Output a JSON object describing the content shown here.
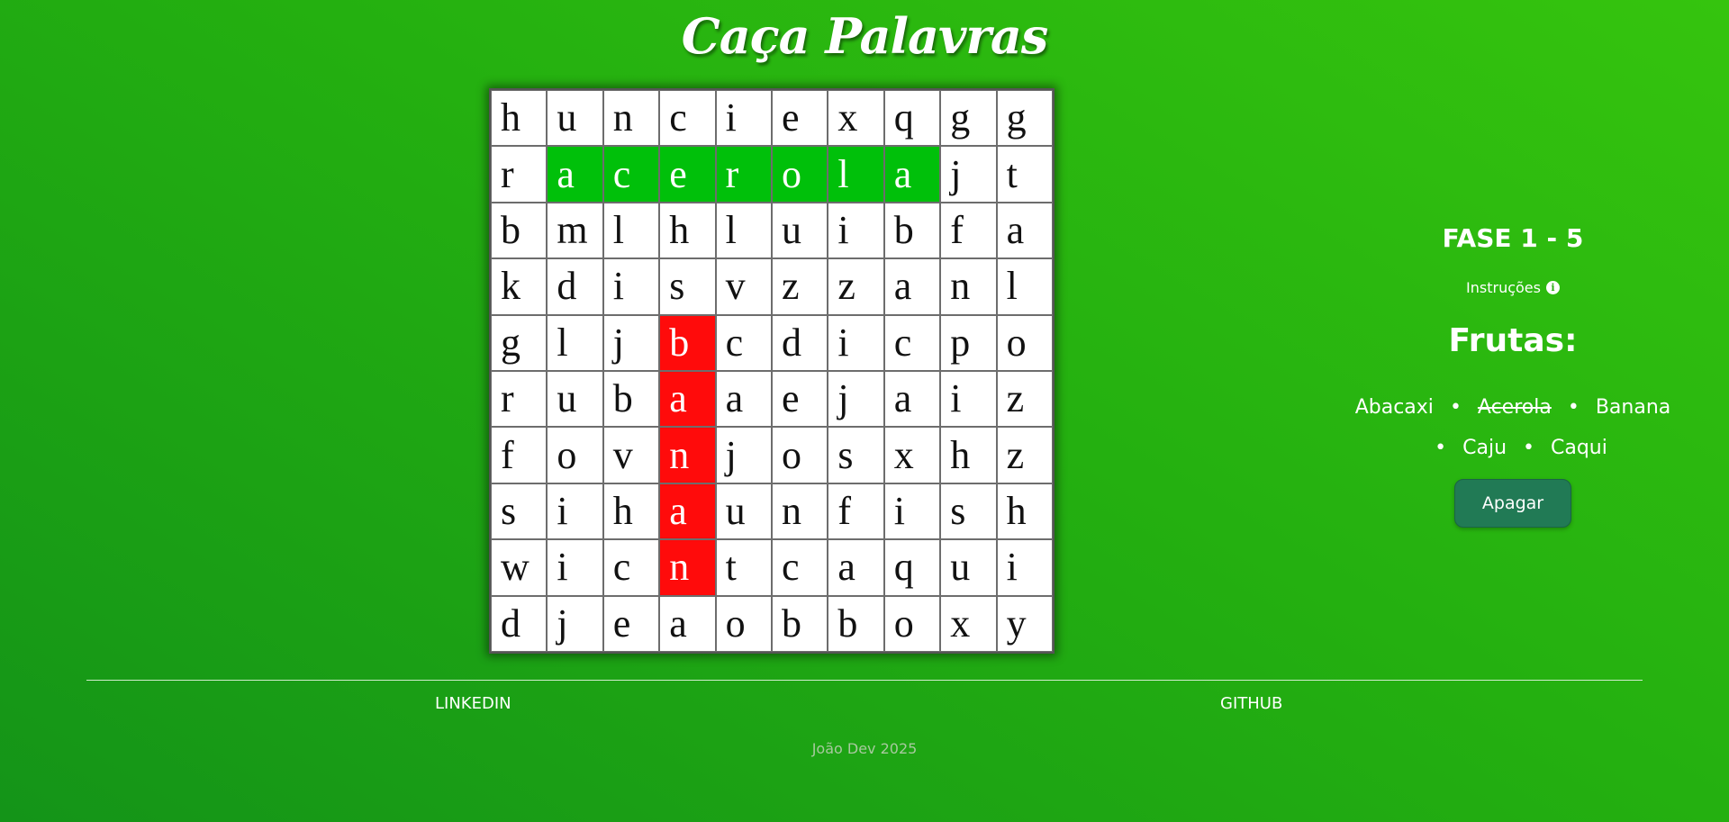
{
  "title": "Caça Palavras",
  "grid": [
    [
      "h",
      "u",
      "n",
      "c",
      "i",
      "e",
      "x",
      "q",
      "g",
      "g"
    ],
    [
      "r",
      "a",
      "c",
      "e",
      "r",
      "o",
      "l",
      "a",
      "j",
      "t"
    ],
    [
      "b",
      "m",
      "l",
      "h",
      "l",
      "u",
      "i",
      "b",
      "f",
      "a"
    ],
    [
      "k",
      "d",
      "i",
      "s",
      "v",
      "z",
      "z",
      "a",
      "n",
      "l"
    ],
    [
      "g",
      "l",
      "j",
      "b",
      "c",
      "d",
      "i",
      "c",
      "p",
      "o"
    ],
    [
      "r",
      "u",
      "b",
      "a",
      "a",
      "e",
      "j",
      "a",
      "i",
      "z"
    ],
    [
      "f",
      "o",
      "v",
      "n",
      "j",
      "o",
      "s",
      "x",
      "h",
      "z"
    ],
    [
      "s",
      "i",
      "h",
      "a",
      "u",
      "n",
      "f",
      "i",
      "s",
      "h"
    ],
    [
      "w",
      "i",
      "c",
      "n",
      "t",
      "c",
      "a",
      "q",
      "u",
      "i"
    ],
    [
      "d",
      "j",
      "e",
      "a",
      "o",
      "b",
      "b",
      "o",
      "x",
      "y"
    ]
  ],
  "highlights": {
    "green": [
      [
        1,
        1
      ],
      [
        1,
        2
      ],
      [
        1,
        3
      ],
      [
        1,
        4
      ],
      [
        1,
        5
      ],
      [
        1,
        6
      ],
      [
        1,
        7
      ]
    ],
    "red": [
      [
        4,
        3
      ],
      [
        5,
        3
      ],
      [
        6,
        3
      ],
      [
        7,
        3
      ],
      [
        8,
        3
      ]
    ],
    "green_color": "#00c00a",
    "red_color": "#ff0b0b"
  },
  "panel": {
    "phase": "FASE 1 - 5",
    "instructions": "Instruções",
    "instructions_icon": "info-icon",
    "category": "Frutas:",
    "words": [
      {
        "text": "Abacaxi",
        "found": false
      },
      {
        "text": "Acerola",
        "found": true
      },
      {
        "text": "Banana",
        "found": false
      },
      {
        "text": "Caju",
        "found": false
      },
      {
        "text": "Caqui",
        "found": false
      }
    ],
    "erase_button": "Apagar"
  },
  "footer": {
    "linkedin": "LINKEDIN",
    "github": "GITHUB",
    "copyright": "João Dev 2025"
  },
  "colors": {
    "background_light": "#35c40e",
    "background_dark": "#149418",
    "button": "#217a55"
  }
}
